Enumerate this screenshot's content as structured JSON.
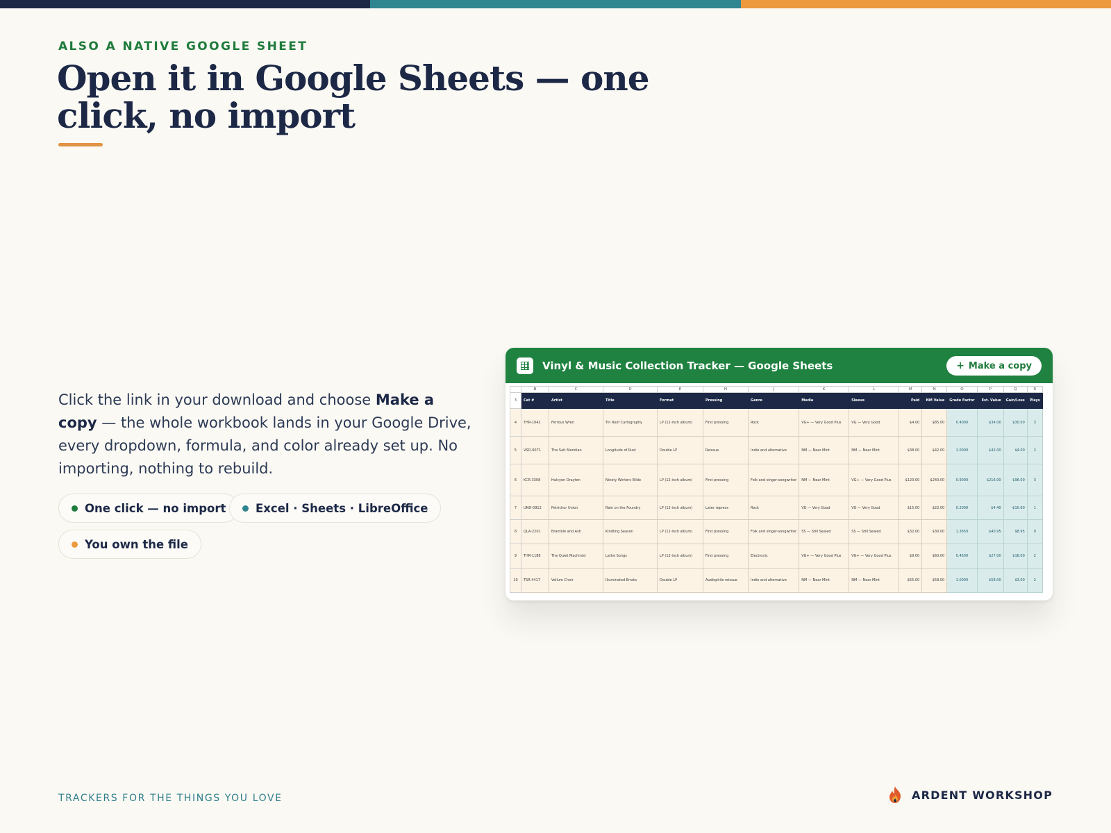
{
  "colors": {
    "navy": "#1c2846",
    "teal": "#2f8590",
    "orange": "#ec9a3d",
    "green": "#1f8240",
    "background": "#fbf9f4"
  },
  "eyebrow": "ALSO A NATIVE GOOGLE SHEET",
  "title": "Open it in Google Sheets — one click, no import",
  "body": {
    "part1": "Click the link in your download and choose ",
    "bold": "Make a copy",
    "part2": " — the whole workbook lands in your Google Drive, every dropdown, formula, and color already set up. No importing, nothing to rebuild."
  },
  "pills": [
    {
      "label": "One click — no import",
      "dot_color": "#1f7c3c"
    },
    {
      "label": "Excel · Sheets · LibreOffice",
      "dot_color": "#2f8590"
    },
    {
      "label": "You own the file",
      "dot_color": "#ec9a3d"
    }
  ],
  "sheet": {
    "title": "Vinyl & Music Collection Tracker — Google Sheets",
    "make_copy_label": "Make a copy",
    "column_letters": [
      "",
      "B",
      "C",
      "D",
      "E",
      "H",
      "J",
      "K",
      "L",
      "M",
      "N",
      "O",
      "P",
      "Q",
      "R"
    ],
    "header_row_number": "3",
    "headers": [
      "Cat #",
      "Artist",
      "Title",
      "Format",
      "Pressing",
      "Genre",
      "Media",
      "Sleeve",
      "Paid",
      "NM Value",
      "Grade Factor",
      "Est. Value",
      "Gain/Loss",
      "Plays"
    ],
    "rows": [
      {
        "n": "4",
        "cells": [
          "THR-1042",
          "Ferrous Wren",
          "Tin Roof Cartography",
          "LP (12-inch album)",
          "First pressing",
          "Rock",
          "VG+ — Very Good Plus",
          "VG — Very Good",
          "$4.00",
          "$85.00",
          "0.4000",
          "$34.00",
          "$30.00",
          "3"
        ]
      },
      {
        "n": "5",
        "cells": [
          "VSD-0071",
          "The Salt Meridian",
          "Longitude of Rust",
          "Double LP",
          "Reissue",
          "Indie and alternative",
          "NM — Near Mint",
          "NM — Near Mint",
          "$38.00",
          "$42.00",
          "1.0000",
          "$42.00",
          "$4.00",
          "2"
        ]
      },
      {
        "n": "6",
        "cells": [
          "KCR-3308",
          "Halcyon Drayton",
          "Ninety Winters Wide",
          "LP (12-inch album)",
          "First pressing",
          "Folk and singer-songwriter",
          "NM — Near Mint",
          "VG+ — Very Good Plus",
          "$120.00",
          "$240.00",
          "0.9000",
          "$216.00",
          "$96.00",
          "3"
        ]
      },
      {
        "n": "7",
        "cells": [
          "UND-0912",
          "Petrichor Union",
          "Rain on the Foundry",
          "LP (12-inch album)",
          "Later repress",
          "Rock",
          "VG — Very Good",
          "VG — Very Good",
          "$15.00",
          "$22.00",
          "0.2000",
          "$4.40",
          "-$10.60",
          "1"
        ]
      },
      {
        "n": "8",
        "cells": [
          "QLA-2201",
          "Bramble and Ash",
          "Kindling Season",
          "LP (12-inch album)",
          "First pressing",
          "Folk and singer-songwriter",
          "SS — Still Sealed",
          "SS — Still Sealed",
          "$32.00",
          "$30.00",
          "1.3650",
          "$40.95",
          "$8.95",
          "0"
        ]
      },
      {
        "n": "9",
        "cells": [
          "THR-1188",
          "The Quiet Machinist",
          "Lathe Songs",
          "LP (12-inch album)",
          "First pressing",
          "Electronic",
          "VG+ — Very Good Plus",
          "VG+ — Very Good Plus",
          "$9.00",
          "$60.00",
          "0.4500",
          "$27.00",
          "$18.00",
          "2"
        ]
      },
      {
        "n": "10",
        "cells": [
          "TSR-4417",
          "Vellum Choir",
          "Illuminated Errata",
          "Double LP",
          "Audiophile reissue",
          "Indie and alternative",
          "NM — Near Mint",
          "NM — Near Mint",
          "$55.00",
          "$58.00",
          "1.0000",
          "$58.00",
          "$3.00",
          "2"
        ]
      }
    ]
  },
  "footer": {
    "tagline": "TRACKERS FOR THE THINGS YOU LOVE",
    "brand": "ARDENT WORKSHOP"
  }
}
